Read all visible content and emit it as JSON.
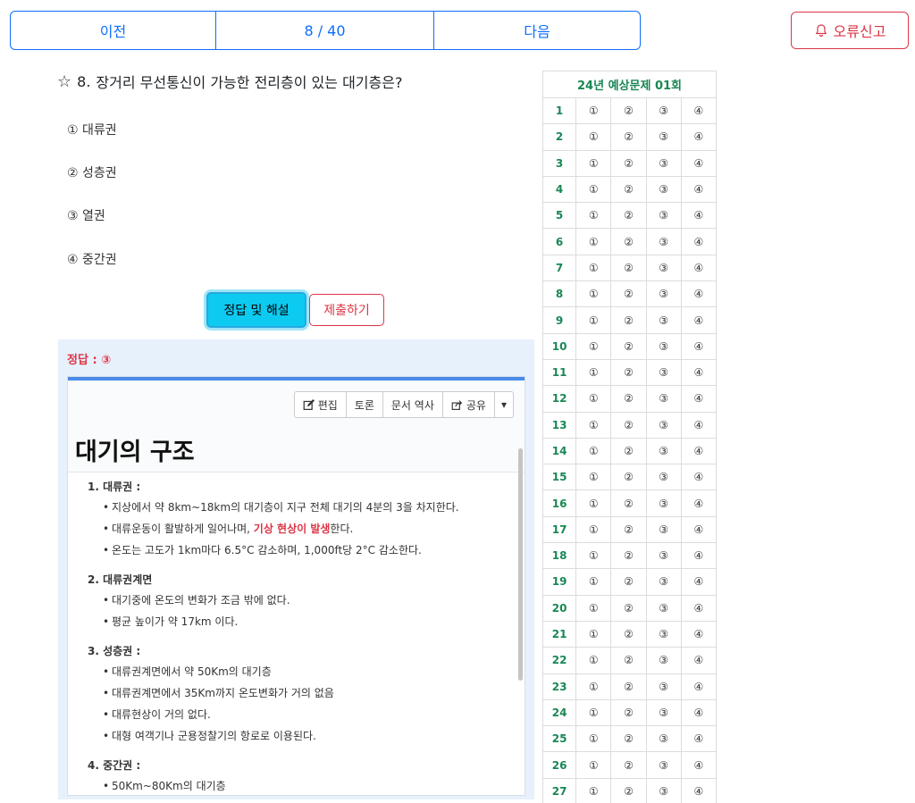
{
  "nav": {
    "prev": "이전",
    "page": "8 / 40",
    "next": "다음",
    "report": "오류신고"
  },
  "question": {
    "number": "8.",
    "text": "장거리 무선통신이 가능한 전리층이 있는 대기층은?"
  },
  "choices": [
    "① 대류권",
    "② 성층권",
    "③ 열권",
    "④ 중간권"
  ],
  "buttons": {
    "answer": "정답 및 해설",
    "submit": "제출하기"
  },
  "answer_label": "정답 : ③",
  "doc": {
    "toolbar": {
      "edit": "편집",
      "discuss": "토론",
      "history": "문서 역사",
      "share": "공유"
    },
    "title": "대기의 구조",
    "sections": [
      {
        "title": "1. 대류권 :",
        "items": [
          "지상에서 약 8km~18km의 대기층이 지구 전체 대기의 4분의 3을 차지한다.",
          "대류운동이 활발하게 일어나며, ",
          "온도는 고도가 1km마다 6.5°C 감소하며, 1,000ft당 2°C 감소한다."
        ],
        "highlight": "기상 현상이 발생",
        "highlight_suffix": "한다."
      },
      {
        "title": "2. 대류권계면",
        "items": [
          "대기중에 온도의 변화가 조금 밖에 없다.",
          "평균 높이가 약 17km 이다."
        ]
      },
      {
        "title": "3. 성층권 :",
        "items": [
          "대류권계면에서 약 50Km의 대기층",
          "대류권계면에서 35Km까지 온도변화가 거의 없음",
          "대류현상이 거의 없다.",
          "대형 여객기나 군용정찰기의 항로로 이용된다."
        ]
      },
      {
        "title": "4. 중간권 :",
        "items": [
          "50Km~80Km의 대기층"
        ]
      }
    ]
  },
  "omr": {
    "title": "24년 예상문제 01회",
    "options": [
      "①",
      "②",
      "③",
      "④"
    ],
    "rows": [
      "1",
      "2",
      "3",
      "4",
      "5",
      "6",
      "7",
      "8",
      "9",
      "10",
      "11",
      "12",
      "13",
      "14",
      "15",
      "16",
      "17",
      "18",
      "19",
      "20",
      "21",
      "22",
      "23",
      "24",
      "25",
      "26",
      "27"
    ]
  }
}
